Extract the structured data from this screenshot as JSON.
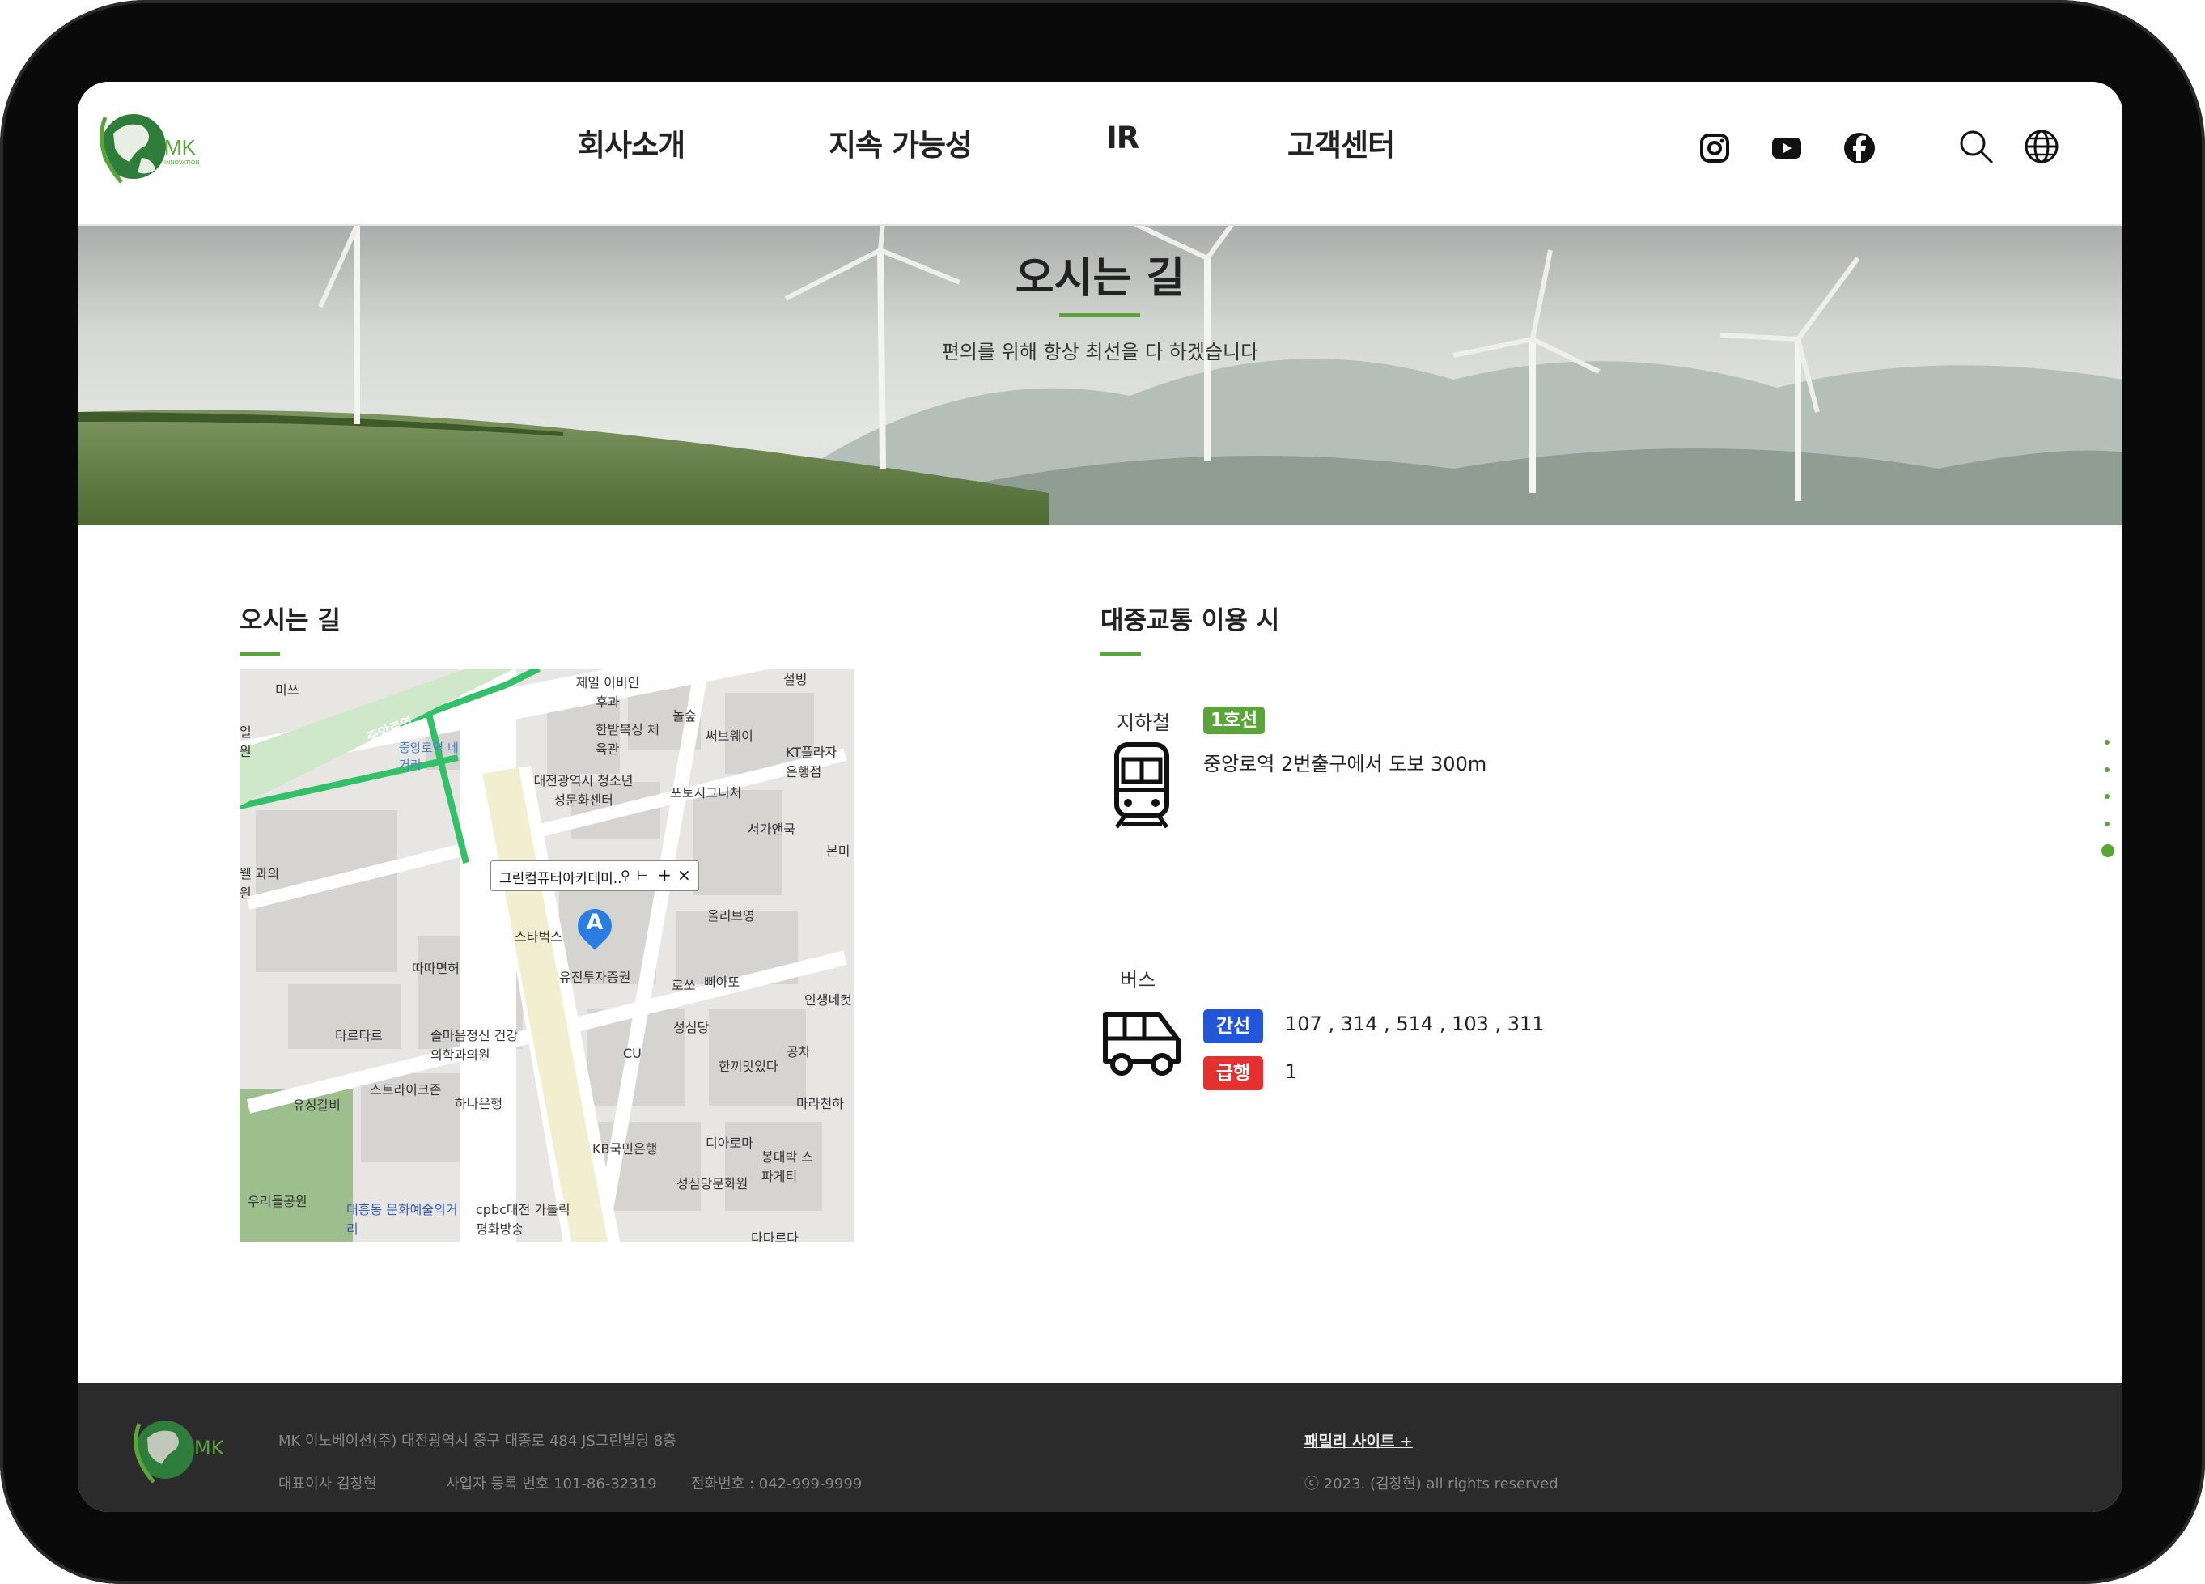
{
  "nav": {
    "brand": "MK",
    "brand_sub": "INNOVATION",
    "items": [
      {
        "label": "회사소개"
      },
      {
        "label": "지속 가능성"
      },
      {
        "label": "IR"
      },
      {
        "label": "고객센터"
      }
    ],
    "social_icons": [
      "instagram-icon",
      "youtube-icon",
      "facebook-icon"
    ],
    "tool_icons": [
      "search-icon",
      "globe-icon"
    ]
  },
  "hero": {
    "title": "오시는 길",
    "subtitle": "편의를 위해 항상 최선을 다 하겠습니다"
  },
  "directions": {
    "title": "오시는 길",
    "map": {
      "popup_title": "그린컴퓨터아카데미..",
      "popup_actions": [
        "pin-icon",
        "route-icon",
        "zoom-in-icon",
        "close-icon"
      ],
      "marker_label": "A",
      "labels": [
        "미쓰",
        "제일 이비인후과",
        "설빙",
        "중앙로역",
        "중앙로역 네거리",
        "한밭복싱 체육관",
        "놀숲",
        "써브웨이",
        "KT플라자 은행점",
        "대전광역시 청소년성문화센터",
        "포토시그니처",
        "서가앤쿡",
        "본미",
        "일 원",
        "웰 과의원",
        "스타벅스",
        "올리브영",
        "유진투자증권",
        "따따면허",
        "로쏘",
        "삐아또",
        "인생네컷",
        "타르타르",
        "솔마음정신 건강의학과의원",
        "성심당",
        "CU",
        "한끼맛있다",
        "공차",
        "스트라이크존",
        "하나은행",
        "마라천하",
        "유성갈비",
        "KB국민은행",
        "디아로마",
        "봉대박 스파게티",
        "우리들공원",
        "대흥동 문화예술의거리",
        "cpbc대전 가톨릭평화방송",
        "성심당문화원",
        "다다르다"
      ]
    }
  },
  "transit": {
    "title": "대중교통 이용 시",
    "subway": {
      "label": "지하철",
      "line_tag": "1호선",
      "line_color": "#5aa53a",
      "route": "중앙로역 2번출구에서 도보 300m"
    },
    "bus": {
      "label": "버스",
      "trunk_tag": "간선",
      "trunk_color": "#2456d9",
      "trunk_routes": "107 , 314 , 514 , 103 , 311",
      "express_tag": "급행",
      "express_color": "#e53030",
      "express_routes": "1"
    }
  },
  "footer": {
    "brand": "MK",
    "address": "MK 이노베이션(주) 대전광역시 중구 대종로 484 JS그린빌딩 8층",
    "ceo": "대표이사 김창현",
    "biz_number": "사업자 등록 번호 101-86-32319",
    "phone": "전화번호 : 042-999-9999",
    "family_site": "패밀리 사이트 +",
    "copyright": "ⓒ 2023. (김창현) all rights reserved"
  },
  "colors": {
    "accent": "#5aa53a",
    "footer_bg": "#2b2b2b"
  }
}
